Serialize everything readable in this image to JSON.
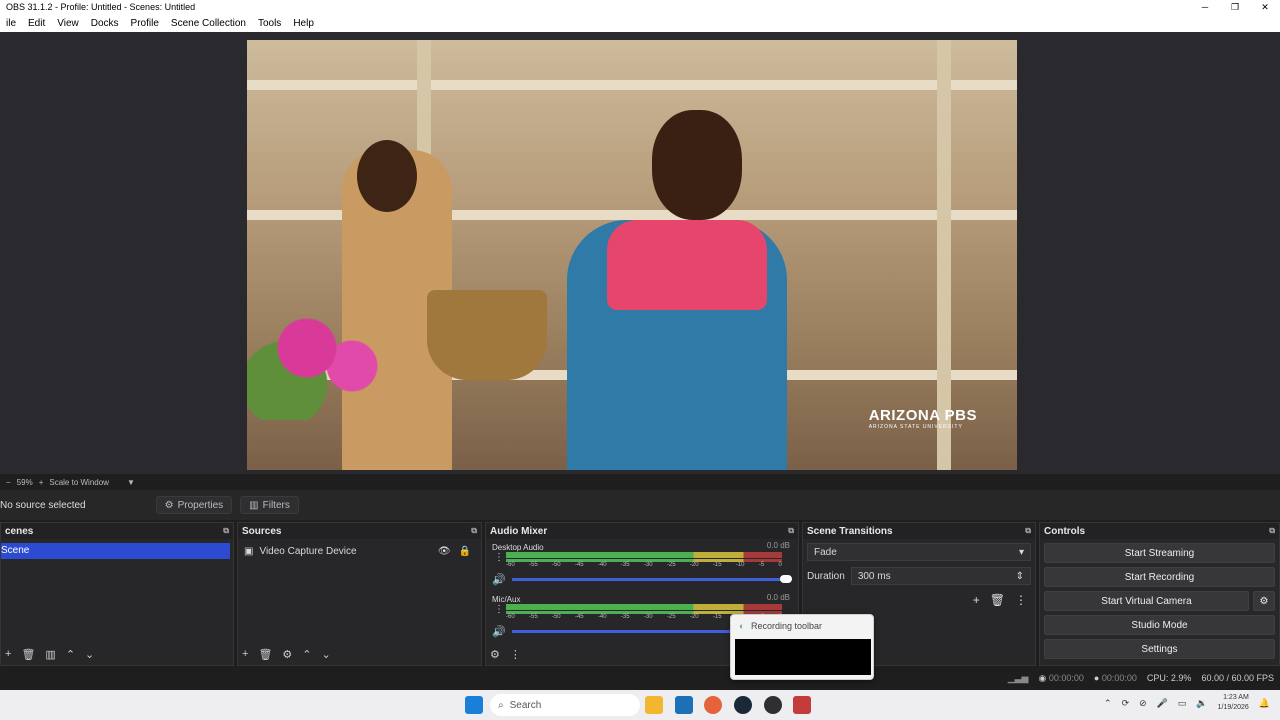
{
  "window": {
    "title": "OBS 31.1.2 - Profile: Untitled - Scenes: Untitled",
    "minimize": "─",
    "maximize": "❐",
    "close": "✕"
  },
  "menu": [
    "ile",
    "Edit",
    "View",
    "Docks",
    "Profile",
    "Scene Collection",
    "Tools",
    "Help"
  ],
  "preview": {
    "watermark_main": "ARIZONA PBS",
    "watermark_sub": "ARIZONA STATE UNIVERSITY",
    "zoom": "59%",
    "scale_mode": "Scale to Window"
  },
  "source_toolbar": {
    "no_source": "No source selected",
    "properties": "Properties",
    "filters": "Filters"
  },
  "scenes": {
    "title": "cenes",
    "items": [
      "Scene"
    ]
  },
  "sources": {
    "title": "Sources",
    "items": [
      {
        "name": "Video Capture Device",
        "icon": "camera-icon"
      }
    ]
  },
  "audio_mixer": {
    "title": "Audio Mixer",
    "scale": [
      "-60",
      "-55",
      "-50",
      "-45",
      "-40",
      "-35",
      "-30",
      "-25",
      "-20",
      "-15",
      "-10",
      "-5",
      "0"
    ],
    "channels": [
      {
        "name": "Desktop Audio",
        "db": "0.0 dB",
        "level": 1.0
      },
      {
        "name": "Mic/Aux",
        "db": "0.0 dB",
        "level": 1.0
      }
    ]
  },
  "transitions": {
    "title": "Scene Transitions",
    "selected": "Fade",
    "duration_label": "Duration",
    "duration_value": "300 ms"
  },
  "controls": {
    "title": "Controls",
    "start_streaming": "Start Streaming",
    "start_recording": "Start Recording",
    "start_virtual_camera": "Start Virtual Camera",
    "studio_mode": "Studio Mode",
    "settings": "Settings"
  },
  "status": {
    "stream_time": "00:00:00",
    "rec_time": "00:00:00",
    "cpu": "CPU: 2.9%",
    "fps": "60.00 / 60.00 FPS"
  },
  "taskbar": {
    "search_placeholder": "Search",
    "time": "1:23 AM",
    "date": "1/19/2026"
  },
  "popup": {
    "label": "Recording toolbar"
  },
  "colors": {
    "selected_scene": "#2d4bd0",
    "meter_green": "#4caf50",
    "meter_yellow": "#c0ae3a",
    "meter_red": "#a53a3a",
    "slider_blue": "#3d5fd8"
  }
}
